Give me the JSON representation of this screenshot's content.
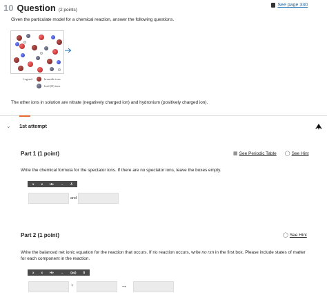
{
  "question": {
    "number": "10",
    "title": "Question",
    "points": "(2 points)",
    "see_page": "See page 330",
    "prompt": "Given the particulate model for a chemical reaction, answer the following questions.",
    "legend_label": "Legend:",
    "legend": [
      {
        "name": "bromide ions"
      },
      {
        "name": "lead (II) ions"
      }
    ],
    "other_ions": "The other ions in solution are nitrate (negatively charged ion) and hydronium (positively charged ion)."
  },
  "attempt": {
    "label": "1st attempt"
  },
  "part1": {
    "title": "Part 1   (1 point)",
    "periodic_table": "See Periodic Table",
    "hint": "See Hint",
    "instruction": "Write the chemical formula for the spectator ions. If there are no spectator ions, leave the boxes empty.",
    "toolbar": [
      "x",
      "x",
      "He",
      "→",
      "δ"
    ],
    "and": "and"
  },
  "part2": {
    "title": "Part 2   (1 point)",
    "hint": "See Hint",
    "instruction_a": "Write the balanced net ionic equation for the reaction that occurs. If no reaction occurs, write ",
    "instruction_em": "no rxn",
    "instruction_b": " in the first box. Please include states of matter for each component in the reaction.",
    "toolbar": [
      "x",
      "x",
      "He",
      "→",
      "(aq)",
      "δ"
    ],
    "plus": "+",
    "arrow": "→"
  },
  "colors": {
    "accent": "#e56a2a",
    "link": "#1a6fb3",
    "input_bg": "#ebebeb",
    "toolbar_bg": "#4a4a4a"
  }
}
